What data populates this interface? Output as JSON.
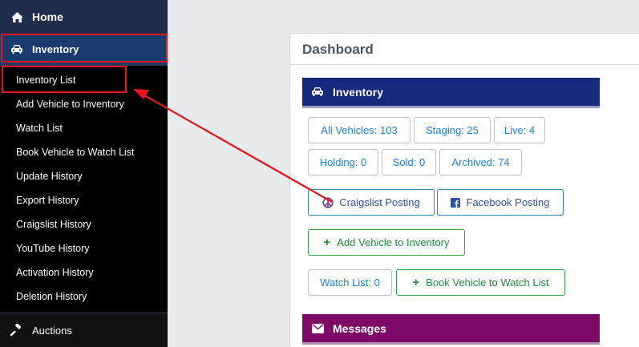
{
  "sidebar": {
    "home": "Home",
    "inventory": "Inventory",
    "items": [
      "Inventory List",
      "Add Vehicle to Inventory",
      "Watch List",
      "Book Vehicle to Watch List",
      "Update History",
      "Export History",
      "Craigslist History",
      "YouTube History",
      "Activation History",
      "Deletion History"
    ],
    "auctions": "Auctions"
  },
  "main": {
    "title": "Dashboard",
    "inventory_header": "Inventory",
    "stats": {
      "all": "All Vehicles: 103",
      "staging": "Staging: 25",
      "live": "Live: 4",
      "holding": "Holding: 0",
      "sold": "Sold: 0",
      "archived": "Archived: 74"
    },
    "craigslist": "Craigslist Posting",
    "facebook": "Facebook Posting",
    "add_vehicle": "Add Vehicle to Inventory",
    "watch_list": "Watch List: 0",
    "book_vehicle": "Book Vehicle to Watch List",
    "messages_header": "Messages"
  },
  "colors": {
    "sidebar_bg": "#000000",
    "inventory_header": "#15297d",
    "messages_header": "#7c0a67",
    "link_blue": "#1f80d6",
    "action_green": "#1e8c3a",
    "highlight_red": "#e8141b"
  }
}
